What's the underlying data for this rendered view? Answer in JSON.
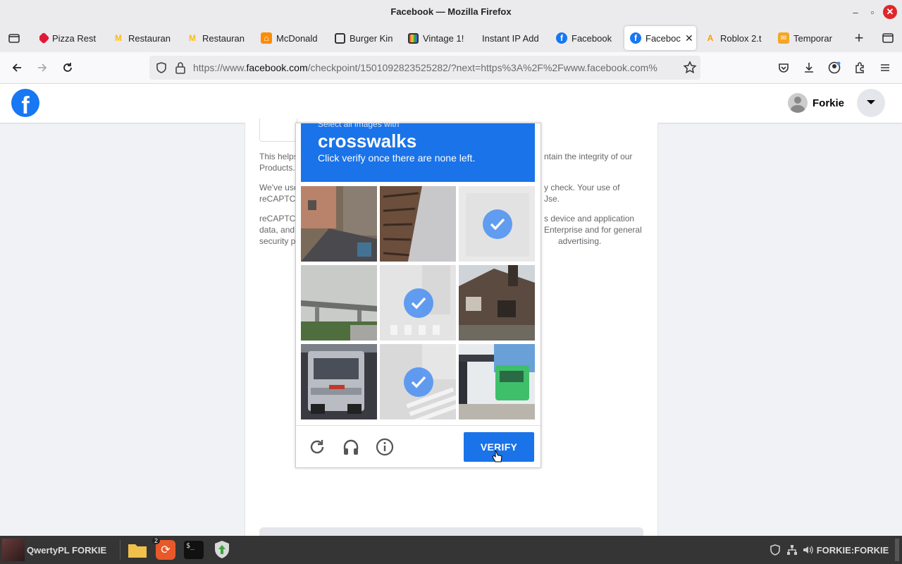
{
  "window": {
    "title": "Facebook — Mozilla Firefox"
  },
  "tabs": [
    {
      "label": "Pizza Rest",
      "icon": "dominos-icon"
    },
    {
      "label": "Restauran",
      "icon": "mcdonalds-icon"
    },
    {
      "label": "Restauran",
      "icon": "mcdonalds-icon"
    },
    {
      "label": "McDonald",
      "icon": "mcdonalds-icon"
    },
    {
      "label": "Burger Kin",
      "icon": "shopping-bag-icon"
    },
    {
      "label": "Vintage 1!",
      "icon": "shopping-bag-icon"
    },
    {
      "label": "Instant IP Add",
      "icon": ""
    },
    {
      "label": "Facebook",
      "icon": "facebook-icon"
    },
    {
      "label": "Faceboc",
      "icon": "facebook-icon",
      "active": true
    },
    {
      "label": "Roblox 2.t",
      "icon": "roblox-icon"
    },
    {
      "label": "Temporar",
      "icon": "mail-icon"
    }
  ],
  "url": {
    "prefix": "https://www.",
    "domain": "facebook.com",
    "rest": "/checkpoint/1501092823525282/?next=https%3A%2F%2Fwww.facebook.com%"
  },
  "fb": {
    "profile_name": "Forkie"
  },
  "card": {
    "p1_left": "This helps",
    "p1_left2": "Products.",
    "p1_right": "ntain the integrity of our",
    "p2_left": "We've use",
    "p2_left2": "reCAPTC",
    "p2_right": "y check. Your use of",
    "p2_right2": "Jse.",
    "p3_left": "reCAPTC",
    "p3_left2": "data, and",
    "p3_left3": "security p",
    "p3_right": "s device and application",
    "p3_right2": "Enterprise and for general",
    "p3_right3": "advertising."
  },
  "captcha": {
    "instruction_top": "Select all images with",
    "keyword": "crosswalks",
    "instruction_bottom": "Click verify once there are none left.",
    "verify_label": "VERIFY",
    "tiles": [
      {
        "name": "street-tile",
        "selected": false
      },
      {
        "name": "building-tile",
        "selected": false
      },
      {
        "name": "faded-tile",
        "selected": true
      },
      {
        "name": "overpass-tile",
        "selected": false
      },
      {
        "name": "crosswalk-tile",
        "selected": true
      },
      {
        "name": "house-tile",
        "selected": false
      },
      {
        "name": "truck-tile",
        "selected": false
      },
      {
        "name": "crosswalk-corner-tile",
        "selected": true
      },
      {
        "name": "green-truck-tile",
        "selected": false
      }
    ]
  },
  "taskbar": {
    "user_label": "QwertyPL FORKIE",
    "badge": "2",
    "tray_label": "FORKIE:FORKIE"
  },
  "colors": {
    "facebook_blue": "#1877f2",
    "captcha_blue": "#1a73e8"
  }
}
